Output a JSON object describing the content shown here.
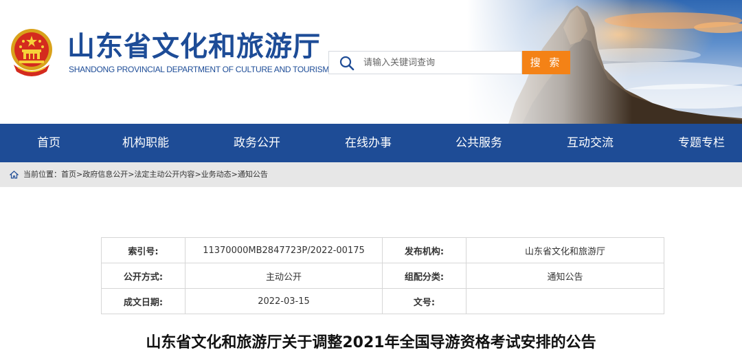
{
  "header": {
    "title": "山东省文化和旅游厅",
    "subtitle": "SHANDONG PROVINCIAL DEPARTMENT OF CULTURE AND TOURISM",
    "emblem_icon": "national-emblem-icon"
  },
  "search": {
    "placeholder": "请输入关键词查询",
    "button_label": "搜 索",
    "accent_color": "#f48216"
  },
  "nav": {
    "background_color": "#1e4c96",
    "items": [
      {
        "label": "首页"
      },
      {
        "label": "机构职能"
      },
      {
        "label": "政务公开"
      },
      {
        "label": "在线办事"
      },
      {
        "label": "公共服务"
      },
      {
        "label": "互动交流"
      },
      {
        "label": "专题专栏"
      }
    ]
  },
  "breadcrumb": {
    "prefix": "当前位置：",
    "items": [
      "首页",
      "政府信息公开",
      "法定主动公开内容",
      "业务动态",
      "通知公告"
    ],
    "separator": ">"
  },
  "info": {
    "index_label": "索引号:",
    "index_value": "11370000MB2847723P/2022-00175",
    "publisher_label": "发布机构:",
    "publisher_value": "山东省文化和旅游厅",
    "disclosure_label": "公开方式:",
    "disclosure_value": "主动公开",
    "category_label": "组配分类:",
    "category_value": "通知公告",
    "date_label": "成文日期:",
    "date_value": "2022-03-15",
    "doc_no_label": "文号:",
    "doc_no_value": ""
  },
  "article": {
    "title": "山东省文化和旅游厅关于调整2021年全国导游资格考试安排的公告"
  }
}
